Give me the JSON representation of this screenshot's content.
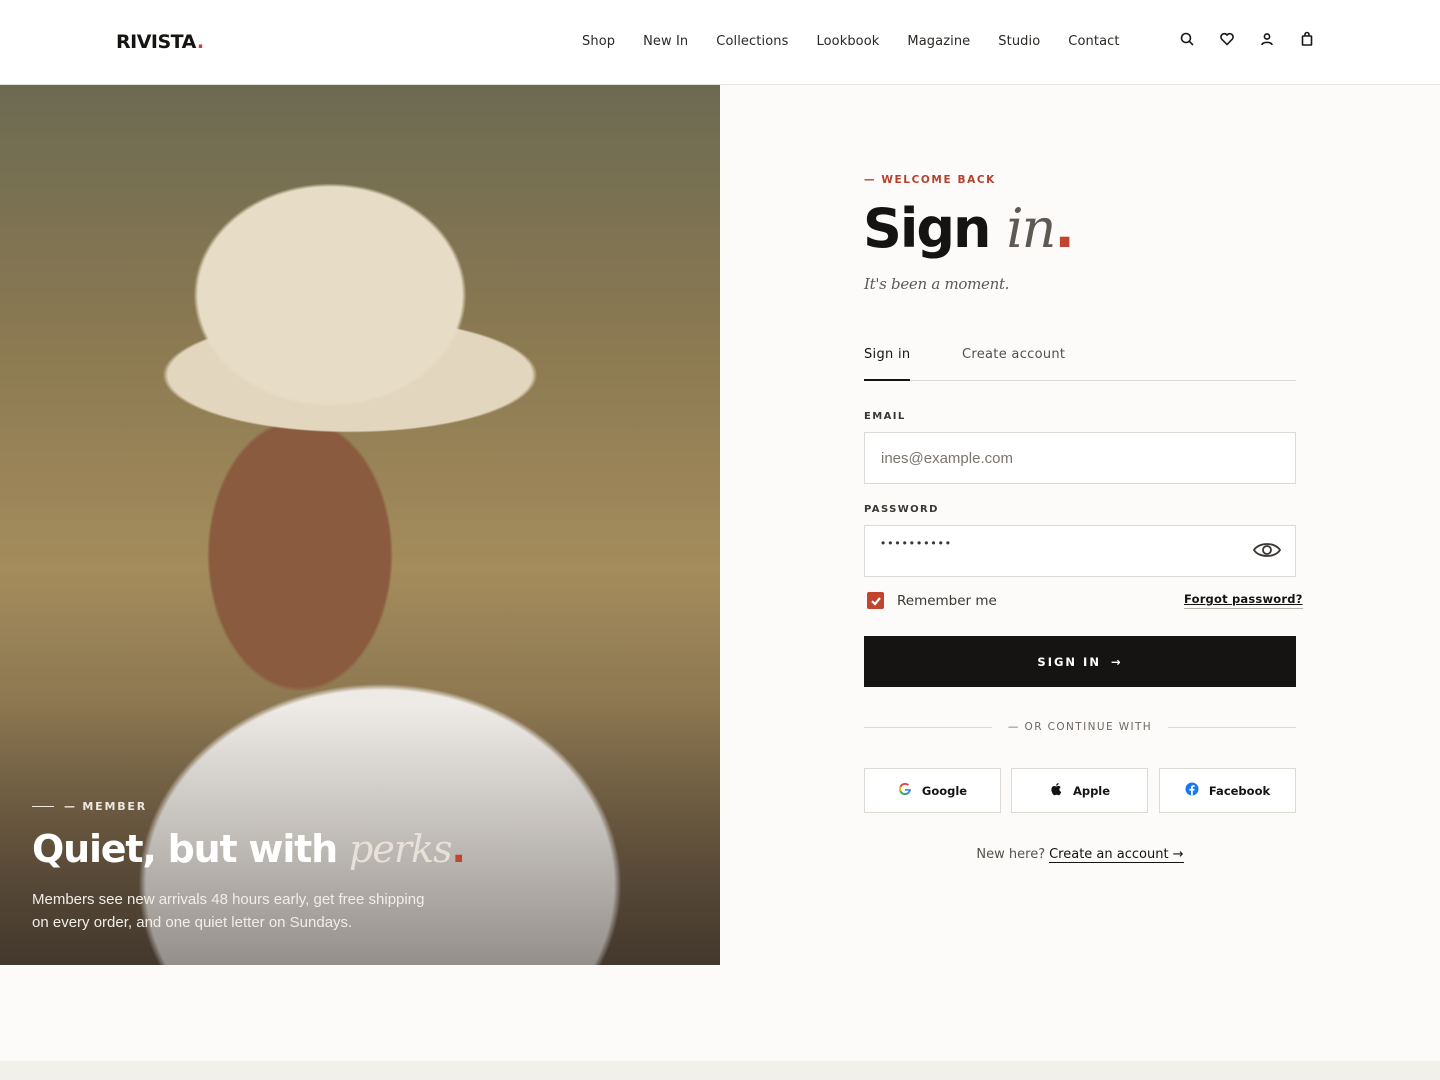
{
  "brand": {
    "name": "RIVISTA",
    "dot": ".",
    "accent": "#c0442e"
  },
  "nav": [
    "Shop",
    "New In",
    "Collections",
    "Lookbook",
    "Magazine",
    "Studio",
    "Contact"
  ],
  "header_icons": [
    "search-icon",
    "heart-icon",
    "user-icon",
    "bag-icon"
  ],
  "hero": {
    "kicker": "— MEMBER",
    "title_main": "Quiet, but with ",
    "title_italic": "perks",
    "title_dot": ".",
    "body": "Members see new arrivals 48 hours early, get free shipping on every order, and one quiet letter on Sundays."
  },
  "form": {
    "kicker": "— WELCOME BACK",
    "title_main": "Sign ",
    "title_italic": "in",
    "title_dot": ".",
    "subtitle": "It's been a moment.",
    "tabs": [
      {
        "label": "Sign in",
        "active": true
      },
      {
        "label": "Create account",
        "active": false
      }
    ],
    "email_label": "EMAIL",
    "email_placeholder": "ines@example.com",
    "password_label": "PASSWORD",
    "password_mask": "••••••••••",
    "remember_label": "Remember me",
    "remember_checked": true,
    "forgot_label": "Forgot password?",
    "submit_label": "SIGN IN",
    "submit_arrow": "→",
    "divider_label": "— OR CONTINUE WITH",
    "social": [
      "Google",
      "Apple",
      "Facebook"
    ],
    "new_here": "New here?",
    "create_link": "Create an account →"
  }
}
